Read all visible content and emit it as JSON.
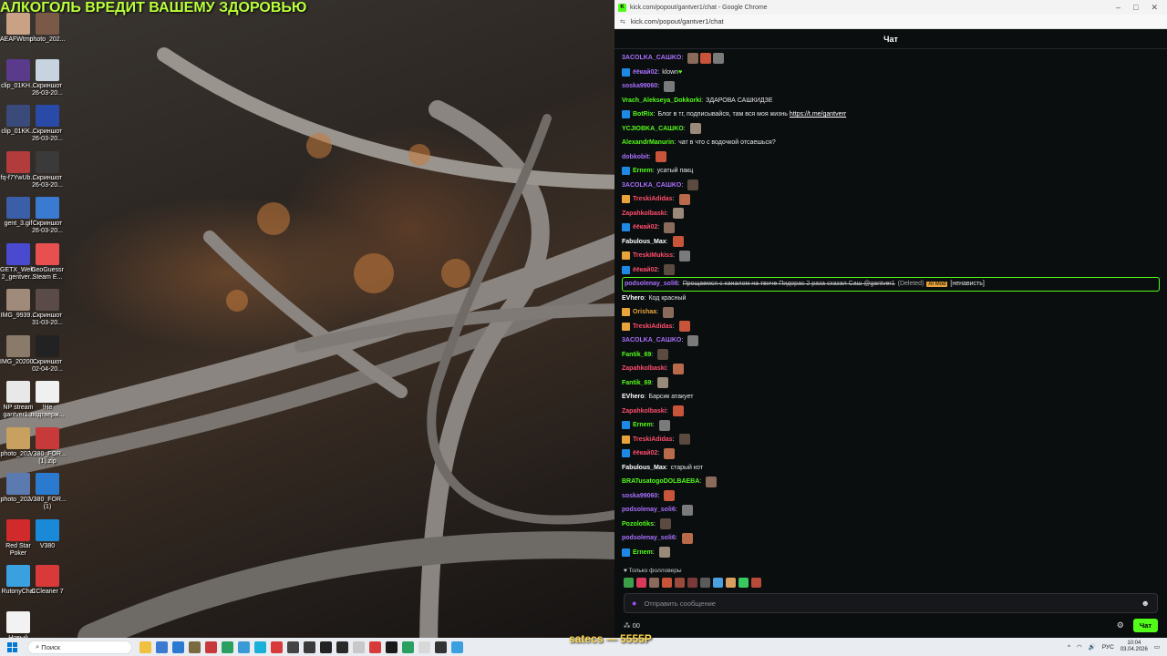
{
  "desktop": {
    "banner": "АЛКОГОЛЬ ВРЕДИТ ВАШЕМУ ЗДОРОВЬЮ",
    "icons": [
      {
        "label": "AEAFWtmc...",
        "color": "#c9a184"
      },
      {
        "label": "photo_202...",
        "color": "#7a5a46"
      },
      {
        "label": "clip_01KH...",
        "color": "#5a3a8a"
      },
      {
        "label": "Скриншот 26-03-20...",
        "color": "#c7d3de"
      },
      {
        "label": "clip_01KK...",
        "color": "#3a4a7a"
      },
      {
        "label": "Скриншот 26-03-20...",
        "color": "#2a4aa8"
      },
      {
        "label": "fq-f7YwUb...",
        "color": "#b23b3b"
      },
      {
        "label": "Скриншот 26-03-20...",
        "color": "#3a3a3a"
      },
      {
        "label": "gent_3.gif",
        "color": "#3b5ea8"
      },
      {
        "label": "Скриншот 26-03-20...",
        "color": "#3a7ad0"
      },
      {
        "label": "GETX_Welc... 2_gentver...",
        "color": "#4a4ad0"
      },
      {
        "label": "GeoGuessr Steam E...",
        "color": "#e85050"
      },
      {
        "label": "IMG_9939...",
        "color": "#a08a7a"
      },
      {
        "label": "Скриншот 31-03-20...",
        "color": "#5a4a48"
      },
      {
        "label": "IMG_20200...",
        "color": "#8a7a6a"
      },
      {
        "label": "Скриншот 02-04-20...",
        "color": "#222222"
      },
      {
        "label": "NP stream gantver1...",
        "color": "#e8e8e8"
      },
      {
        "label": "!Не подтверж...",
        "color": "#f0f0f0"
      },
      {
        "label": "photo_202...",
        "color": "#c8a060"
      },
      {
        "label": "V380_FOR... (1).zip",
        "color": "#c83a3a"
      },
      {
        "label": "photo_202...",
        "color": "#5a7ab0"
      },
      {
        "label": "V380_FOR... (1)",
        "color": "#2a7ad0"
      },
      {
        "label": "Red Star Poker",
        "color": "#d02a2a"
      },
      {
        "label": "V380",
        "color": "#1a8ad8"
      },
      {
        "label": "RutonyChat",
        "color": "#3aa0e0"
      },
      {
        "label": "CCleaner 7",
        "color": "#d83a3a"
      },
      {
        "label": "Новый текстовый ...",
        "color": "#f2f2f2"
      }
    ]
  },
  "browser": {
    "title": "kick.com/popout/gantver1/chat - Google Chrome",
    "favicon": "K",
    "url": "kick.com/popout/gantver1/chat",
    "chat_title": "Чат"
  },
  "messages": [
    {
      "user": "3ACOLKA_CAШKO",
      "color": "#a970ff",
      "badge": null,
      "text": "",
      "emotes": 3
    },
    {
      "user": "ёёкай02",
      "color": "#a970ff",
      "badge": "#1e88e5",
      "text": "klown",
      "emotes": 0,
      "heart": true
    },
    {
      "user": "soska99060",
      "color": "#a970ff",
      "badge": null,
      "text": "",
      "emotes": 1
    },
    {
      "user": "Vrach_Alekseya_Dokkorki",
      "color": "#53fc18",
      "badge": null,
      "text": "ЗДАРОВА САШКИДЗЕ",
      "emotes": 0
    },
    {
      "user": "BotRix",
      "color": "#53fc18",
      "badge": "#1e88e5",
      "text": "Блог в тг, подписывайся, там вся моя жизнь",
      "link": "https://t.me/gantverr",
      "emotes": 0
    },
    {
      "user": "YCJIOBKA_CAШKO",
      "color": "#53fc18",
      "badge": null,
      "text": "",
      "emotes": 1
    },
    {
      "user": "AlexandrManurin",
      "color": "#53fc18",
      "badge": null,
      "text": "чат в что с водочкой отсаешься?",
      "emotes": 0
    },
    {
      "user": "dobkobit",
      "color": "#a970ff",
      "badge": null,
      "text": "",
      "emotes": 1
    },
    {
      "user": "Ernem",
      "color": "#53fc18",
      "badge": "#1e88e5",
      "text": "усатый пакц",
      "emotes": 0
    },
    {
      "user": "3ACOLKA_CAШKO",
      "color": "#a970ff",
      "badge": null,
      "text": "",
      "emotes": 1
    },
    {
      "user": "TreskiAdidas",
      "color": "#ff4d6d",
      "badge": "#e8a33a",
      "text": "",
      "emotes": 1
    },
    {
      "user": "Zapahkolbaski",
      "color": "#ff4d6d",
      "badge": null,
      "text": "",
      "emotes": 1
    },
    {
      "user": "ёёкай02",
      "color": "#ff4d6d",
      "badge": "#1e88e5",
      "text": "",
      "emotes": 1
    },
    {
      "user": "Fabulous_Max",
      "color": "#ffffff",
      "badge": null,
      "text": "",
      "emotes": 1
    },
    {
      "user": "TreskiMukiss",
      "color": "#ff4d6d",
      "badge": "#e8a33a",
      "text": "",
      "emotes": 1
    },
    {
      "user": "ёёкай02",
      "color": "#ff4d6d",
      "badge": "#1e88e5",
      "text": "",
      "emotes": 1
    },
    {
      "user": "podsolenay_soli6",
      "color": "#a970ff",
      "badge": null,
      "highlight": true,
      "text": "Прощаемся с каналом на твиче Пидорас 2 раза сказал Саш @gantver1",
      "deleted": "(Deleted)",
      "tag": "AI Mod",
      "tail": "[ненависть]",
      "emotes": 0
    },
    {
      "user": "EVhero",
      "color": "#ffffff",
      "badge": null,
      "text": "Код красный",
      "emotes": 0
    },
    {
      "user": "Orishaa",
      "color": "#e8a33a",
      "badge": "#e8a33a",
      "text": "",
      "emotes": 1
    },
    {
      "user": "TreskiAdidas",
      "color": "#ff4d6d",
      "badge": "#e8a33a",
      "text": "",
      "emotes": 1
    },
    {
      "user": "3ACOLKA_CAШKO",
      "color": "#a970ff",
      "badge": null,
      "text": "",
      "emotes": 1
    },
    {
      "user": "Fantik_69",
      "color": "#53fc18",
      "badge": null,
      "text": "",
      "emotes": 1
    },
    {
      "user": "Zapahkolbaski",
      "color": "#ff4d6d",
      "badge": null,
      "text": "",
      "emotes": 1
    },
    {
      "user": "Fantik_69",
      "color": "#53fc18",
      "badge": null,
      "text": "",
      "emotes": 1
    },
    {
      "user": "EVhero",
      "color": "#ffffff",
      "badge": null,
      "text": "Барсик атакует",
      "emotes": 0
    },
    {
      "user": "Zapahkolbaski",
      "color": "#ff4d6d",
      "badge": null,
      "text": "",
      "emotes": 1
    },
    {
      "user": "Ernem",
      "color": "#53fc18",
      "badge": "#1e88e5",
      "text": "",
      "emotes": 1
    },
    {
      "user": "TreskiAdidas",
      "color": "#ff4d6d",
      "badge": "#e8a33a",
      "text": "",
      "emotes": 1
    },
    {
      "user": "ёёкай02",
      "color": "#ff4d6d",
      "badge": "#1e88e5",
      "text": "",
      "emotes": 1
    },
    {
      "user": "Fabulous_Max",
      "color": "#ffffff",
      "badge": null,
      "text": "старый кот",
      "emotes": 0
    },
    {
      "user": "BRATusatogoDOLBAEBA",
      "color": "#53fc18",
      "badge": null,
      "text": "",
      "emotes": 1
    },
    {
      "user": "soska99060",
      "color": "#a970ff",
      "badge": null,
      "text": "",
      "emotes": 1
    },
    {
      "user": "podsolenay_soli6",
      "color": "#a970ff",
      "badge": null,
      "text": "",
      "emotes": 1
    },
    {
      "user": "Pozolotiks",
      "color": "#53fc18",
      "badge": null,
      "text": "",
      "emotes": 1
    },
    {
      "user": "podsolenay_soli6",
      "color": "#a970ff",
      "badge": null,
      "text": "",
      "emotes": 1
    },
    {
      "user": "Ernem",
      "color": "#53fc18",
      "badge": "#1e88e5",
      "text": "",
      "emotes": 1
    }
  ],
  "chat": {
    "followers_only": "Только фолловеры",
    "input_placeholder": "Отправить сообщение",
    "points": "00",
    "send_label": "Чат"
  },
  "taskbar": {
    "search_placeholder": "Поиск",
    "overlay": "satecs — 5555P",
    "lang": "РУС",
    "time": "10:04",
    "date": "03.04.2026"
  }
}
